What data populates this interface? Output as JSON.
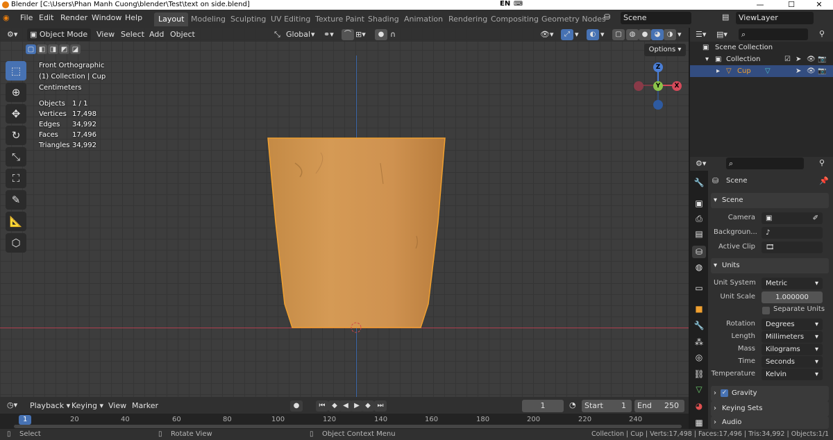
{
  "window": {
    "title": "Blender [C:\\Users\\Phan Manh Cuong\\blender\\Test\\text on side.blend]",
    "lang": "EN",
    "min": "—",
    "max": "☐",
    "close": "✕"
  },
  "topbar": {
    "menus": [
      "File",
      "Edit",
      "Render",
      "Window",
      "Help"
    ],
    "workspaces": [
      "Layout",
      "Modeling",
      "Sculpting",
      "UV Editing",
      "Texture Paint",
      "Shading",
      "Animation",
      "Rendering",
      "Compositing",
      "Geometry Nodes"
    ],
    "active_workspace": "Layout",
    "scene": "Scene",
    "view_layer": "ViewLayer"
  },
  "viewport": {
    "mode": "Object Mode",
    "menus": [
      "View",
      "Select",
      "Add",
      "Object"
    ],
    "transform_orientation": "Global",
    "options_label": "Options",
    "view_name": "Front Orthographic",
    "collection_info": "(1) Collection | Cup",
    "units_info": "Centimeters",
    "stats": [
      {
        "label": "Objects",
        "value": "1 / 1"
      },
      {
        "label": "Vertices",
        "value": "17,498"
      },
      {
        "label": "Edges",
        "value": "34,992"
      },
      {
        "label": "Faces",
        "value": "17,496"
      },
      {
        "label": "Triangles",
        "value": "34,992"
      }
    ],
    "gizmo": {
      "z": "Z",
      "y": "Y",
      "x": "X"
    },
    "colors": {
      "selection_outline": "#f0a030",
      "active_tool": "#4772b3",
      "axis_x": "#b0404f",
      "axis_z": "#3a66a8"
    }
  },
  "timeline": {
    "menus": [
      "Playback",
      "Keying",
      "View",
      "Marker"
    ],
    "current_frame": "1",
    "start_label": "Start",
    "start": "1",
    "end_label": "End",
    "end": "250",
    "ruler": [
      "1",
      "20",
      "40",
      "60",
      "80",
      "100",
      "120",
      "140",
      "160",
      "180",
      "200",
      "220",
      "240"
    ]
  },
  "statusbar": {
    "select": "Select",
    "rotate": "Rotate View",
    "context_menu": "Object Context Menu",
    "info": "Collection | Cup | Verts:17,498 | Faces:17,496 | Tris:34,992 | Objects:1/1"
  },
  "outliner": {
    "root": "Scene Collection",
    "collection": "Collection",
    "object": "Cup"
  },
  "properties": {
    "context": "Scene",
    "scene_section": "Scene",
    "camera_label": "Camera",
    "background_label": "Backgroun...",
    "active_clip_label": "Active Clip",
    "units_section": "Units",
    "unit_system_label": "Unit System",
    "unit_system": "Metric",
    "unit_scale_label": "Unit Scale",
    "unit_scale": "1.000000",
    "separate_units": "Separate Units",
    "rotation_label": "Rotation",
    "rotation": "Degrees",
    "length_label": "Length",
    "length": "Millimeters",
    "mass_label": "Mass",
    "mass": "Kilograms",
    "time_label": "Time",
    "time": "Seconds",
    "temperature_label": "Temperature",
    "temperature": "Kelvin",
    "gravity_section": "Gravity",
    "keying_sets_section": "Keying Sets",
    "audio_section": "Audio"
  }
}
